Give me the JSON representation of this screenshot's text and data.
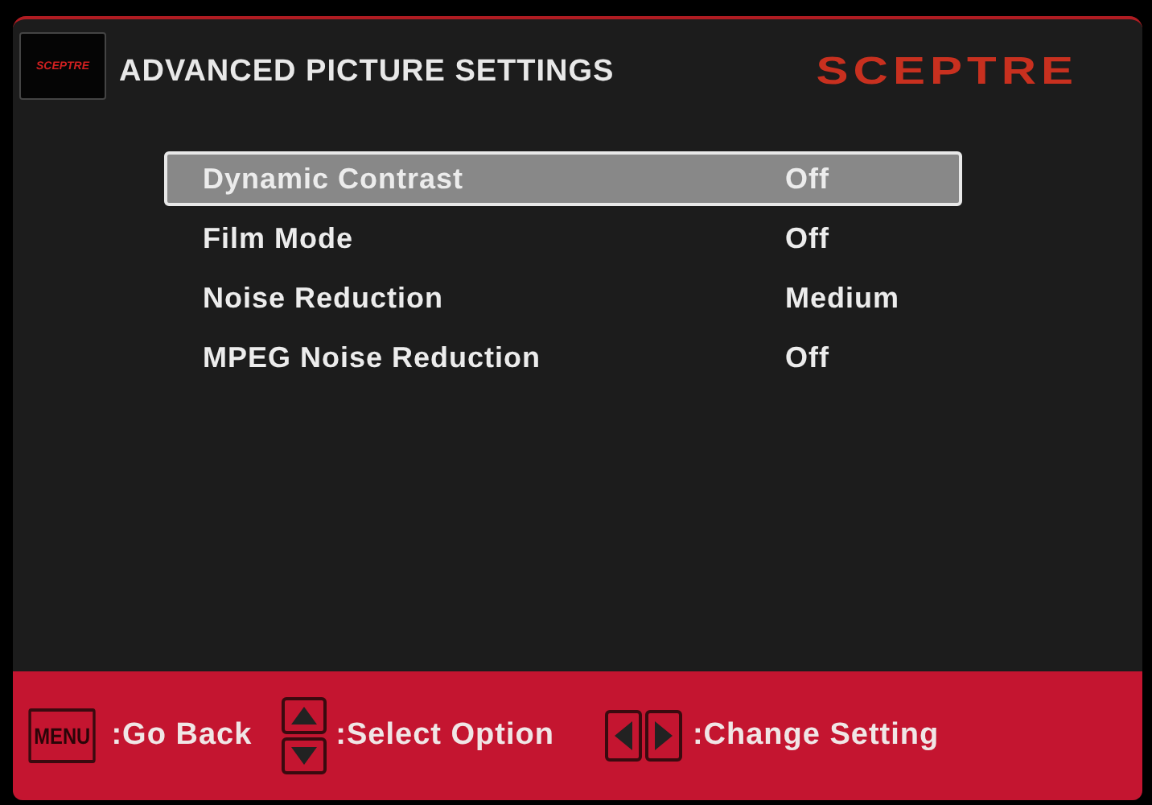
{
  "header": {
    "tv_logo": "SCEPTRE",
    "title": "ADVANCED PICTURE SETTINGS",
    "brand": "SCEPTRE"
  },
  "items": [
    {
      "label": "Dynamic Contrast",
      "value": "Off",
      "selected": true
    },
    {
      "label": "Film Mode",
      "value": "Off",
      "selected": false
    },
    {
      "label": "Noise Reduction",
      "value": "Medium",
      "selected": false
    },
    {
      "label": "MPEG Noise Reduction",
      "value": "Off",
      "selected": false
    }
  ],
  "footer": [
    {
      "kind": "menu",
      "key": "MENU",
      "text": ":Go Back"
    },
    {
      "kind": "updown",
      "text": ":Select Option"
    },
    {
      "kind": "leftright",
      "text": ":Change Setting"
    }
  ]
}
